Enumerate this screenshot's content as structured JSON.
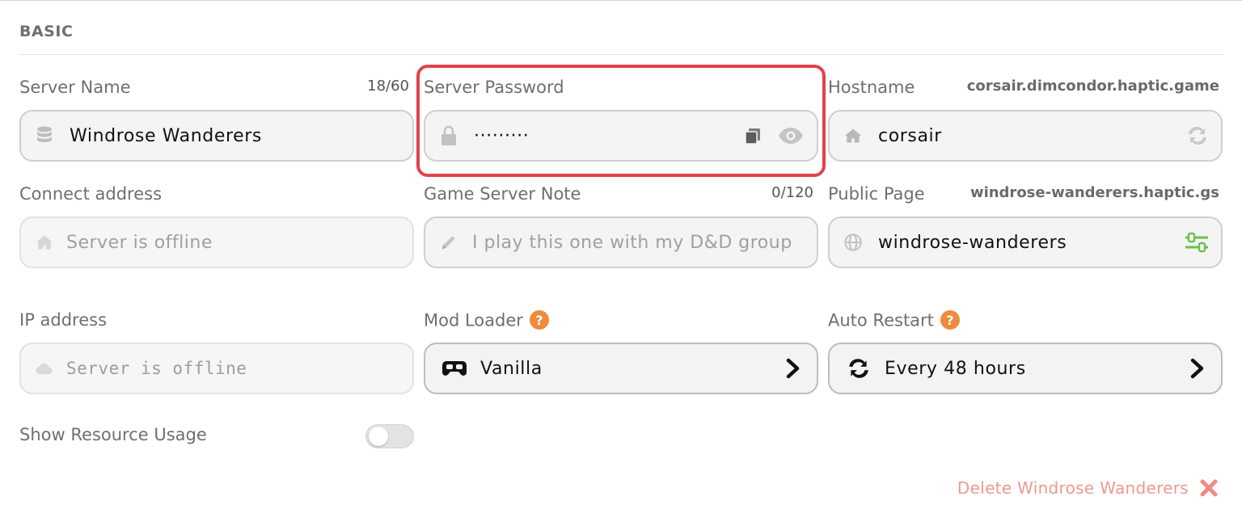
{
  "section": {
    "title": "BASIC"
  },
  "server_name": {
    "label": "Server Name",
    "counter": "18/60",
    "value": "Windrose Wanderers",
    "icon": "database-icon"
  },
  "server_password": {
    "label": "Server Password",
    "value": "·········",
    "icon": "lock-icon",
    "copy_icon": "copy-icon",
    "reveal_icon": "eye-icon"
  },
  "hostname": {
    "label": "Hostname",
    "domain": "corsair.dimcondor.haptic.game",
    "value": "corsair",
    "icon": "home-icon",
    "action_icon": "refresh-icon"
  },
  "connect_address": {
    "label": "Connect address",
    "placeholder": "Server is offline",
    "icon": "home-icon"
  },
  "game_server_note": {
    "label": "Game Server Note",
    "counter": "0/120",
    "placeholder": "I play this one with my D&D group",
    "icon": "pencil-icon"
  },
  "public_page": {
    "label": "Public Page",
    "domain": "windrose-wanderers.haptic.gs",
    "value": "windrose-wanderers",
    "icon": "globe-icon",
    "action_icon": "settings-sliders-icon"
  },
  "ip_address": {
    "label": "IP address",
    "placeholder": "Server is offline",
    "icon": "cloud-icon"
  },
  "mod_loader": {
    "label": "Mod Loader",
    "help": "?",
    "value": "Vanilla",
    "icon": "gamepad-icon"
  },
  "auto_restart": {
    "label": "Auto Restart",
    "help": "?",
    "value": "Every 48 hours",
    "icon": "refresh-icon"
  },
  "resource_usage": {
    "label": "Show Resource Usage",
    "enabled": false
  },
  "delete": {
    "label": "Delete Windrose Wanderers"
  },
  "colors": {
    "highlight": "#e0434b",
    "help": "#f08a3c",
    "delete": "#ec9a90",
    "slider_green": "#6cc04a"
  }
}
